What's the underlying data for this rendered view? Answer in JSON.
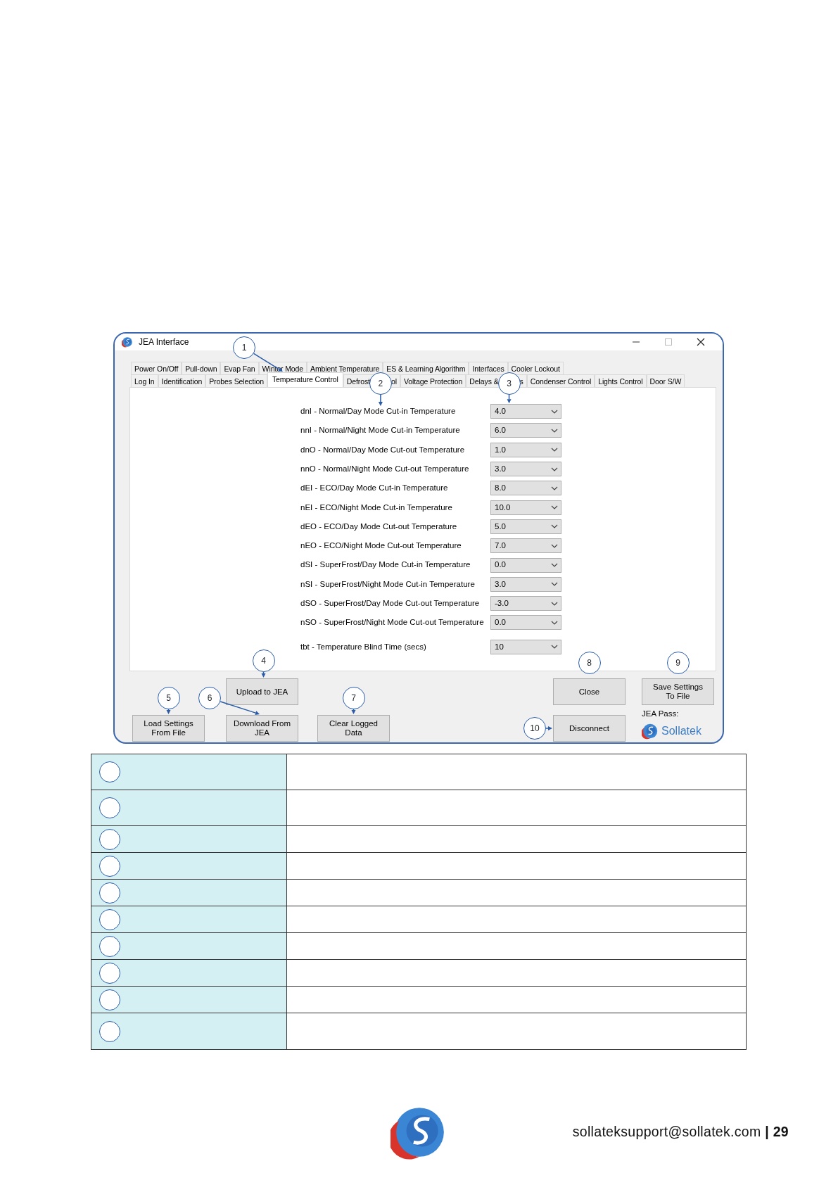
{
  "window": {
    "title": "JEA Interface"
  },
  "tab_rows": [
    {
      "tabs": [
        {
          "label": "Power On/Off",
          "selected": false
        },
        {
          "label": "Pull-down",
          "selected": false
        },
        {
          "label": "Evap Fan",
          "selected": false
        },
        {
          "label": "Winter Mode",
          "selected": false
        },
        {
          "label": "Ambient Temperature",
          "selected": false
        },
        {
          "label": "ES & Learning Algorithm",
          "selected": false
        },
        {
          "label": "Interfaces",
          "selected": false
        },
        {
          "label": "Cooler Lockout",
          "selected": false
        }
      ]
    },
    {
      "tabs": [
        {
          "label": "Log In",
          "selected": false
        },
        {
          "label": "Identification",
          "selected": false
        },
        {
          "label": "Probes Selection",
          "selected": false
        },
        {
          "label": "Temperature Control",
          "selected": true
        },
        {
          "label": "Defrost",
          "label_end": "ol",
          "selected": false
        },
        {
          "label": "Voltage Protection",
          "selected": false
        },
        {
          "label": "Delays &",
          "label_end": "s",
          "selected": false
        },
        {
          "label": "Condenser Control",
          "selected": false
        },
        {
          "label": "Lights Control",
          "selected": false
        },
        {
          "label": "Door S/W",
          "selected": false
        }
      ]
    }
  ],
  "settings": [
    {
      "kind": "temperature",
      "label": "dnI - Normal/Day Mode Cut-in Temperature",
      "value": "4.0"
    },
    {
      "kind": "temperature",
      "label": "nnI - Normal/Night Mode Cut-in Temperature",
      "value": "6.0"
    },
    {
      "kind": "temperature",
      "label": "dnO - Normal/Day Mode Cut-out Temperature",
      "value": "1.0"
    },
    {
      "kind": "temperature",
      "label": "nnO - Normal/Night Mode Cut-out Temperature",
      "value": "3.0"
    },
    {
      "kind": "temperature",
      "label": "dEI - ECO/Day Mode Cut-in Temperature",
      "value": "8.0"
    },
    {
      "kind": "temperature",
      "label": "nEI - ECO/Night Mode Cut-in Temperature",
      "value": "10.0"
    },
    {
      "kind": "temperature",
      "label": "dEO - ECO/Day Mode Cut-out Temperature",
      "value": "5.0"
    },
    {
      "kind": "temperature",
      "label": "nEO - ECO/Night Mode Cut-out Temperature",
      "value": "7.0"
    },
    {
      "kind": "temperature",
      "label": "dSI - SuperFrost/Day Mode Cut-in Temperature",
      "value": "0.0"
    },
    {
      "kind": "temperature",
      "label": "nSI - SuperFrost/Night Mode Cut-in Temperature",
      "value": "3.0"
    },
    {
      "kind": "temperature",
      "label": "dSO - SuperFrost/Day Mode Cut-out Temperature",
      "value": "-3.0"
    },
    {
      "kind": "temperature",
      "label": "nSO - SuperFrost/Night Mode Cut-out Temperature",
      "value": "0.0"
    },
    {
      "kind": "time",
      "label": "tbt - Temperature Blind Time (secs)",
      "value": "10"
    }
  ],
  "buttons": [
    {
      "label": "Upload to JEA"
    },
    {
      "label": "Load Settings From File"
    },
    {
      "label": "Download From JEA"
    },
    {
      "label": "Clear Logged Data"
    },
    {
      "label": "Close"
    },
    {
      "label": "Save Settings To File"
    },
    {
      "label": "Disconnect"
    }
  ],
  "jea_pass": {
    "label": "JEA Pass:",
    "logo_text": "Sollatek"
  },
  "callouts": [
    {
      "number": "1"
    },
    {
      "number": "2"
    },
    {
      "number": "3"
    },
    {
      "number": "4"
    },
    {
      "number": "5"
    },
    {
      "number": "6"
    },
    {
      "number": "7"
    },
    {
      "number": "8"
    },
    {
      "number": "9"
    },
    {
      "number": "10"
    }
  ],
  "legend_table": {
    "rows": [
      {
        "kind": "tall"
      },
      {
        "kind": "tall"
      },
      {
        "kind": "short"
      },
      {
        "kind": "short"
      },
      {
        "kind": "short"
      },
      {
        "kind": "short"
      },
      {
        "kind": "short"
      },
      {
        "kind": "short"
      },
      {
        "kind": "short"
      },
      {
        "kind": "tall"
      }
    ]
  },
  "footer": {
    "contact": "sollateksupport@sollatek.com **| 29**"
  }
}
